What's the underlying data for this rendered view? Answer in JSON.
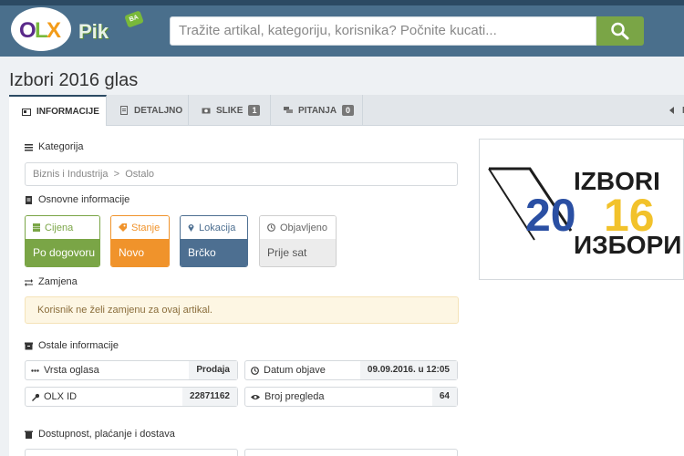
{
  "header": {
    "logo_text": "OLX",
    "pik_text": "Pik",
    "pik_tag": "BA",
    "search_placeholder": "Tražite artikal, kategoriju, korisnika? Počnite kucati..."
  },
  "page": {
    "title": "Izbori 2016 glas"
  },
  "tabs": [
    {
      "label": "INFORMACIJE",
      "icon": "info-card-icon",
      "active": true
    },
    {
      "label": "DETALJNO",
      "icon": "document-icon"
    },
    {
      "label": "SLIKE",
      "icon": "camera-icon",
      "badge": "1"
    },
    {
      "label": "PITANJA",
      "icon": "chat-icon",
      "badge": "0"
    }
  ],
  "tab_right_label": "NA",
  "sections": {
    "kategorija": "Kategorija",
    "osnovne": "Osnovne informacije",
    "zamjena": "Zamjena",
    "ostale": "Ostale informacije",
    "dostupnost": "Dostupnost, plaćanje i dostava"
  },
  "breadcrumb": {
    "level1": "Biznis i Industrija",
    "separator": ">",
    "level2": "Ostalo"
  },
  "cards": [
    {
      "label": "Cijena",
      "value": "Po dogovoru",
      "color": "#7aa546",
      "icon": "money-icon"
    },
    {
      "label": "Stanje",
      "value": "Novo",
      "color": "#f0932b",
      "icon": "tag-icon"
    },
    {
      "label": "Lokacija",
      "value": "Brčko",
      "color": "#4d6f91",
      "icon": "map-pin-icon"
    },
    {
      "label": "Objavljeno",
      "value": "Prije sat",
      "color": "#e6e6e6",
      "icon": "clock-icon"
    }
  ],
  "zamjena_notice": "Korisnik ne želi zamjenu za ovaj artikal.",
  "details": [
    {
      "label": "Vrsta oglasa",
      "value": "Prodaja",
      "icon": "dots-icon"
    },
    {
      "label": "Datum objave",
      "value": "09.09.2016. u 12:05",
      "icon": "clock-icon"
    },
    {
      "label": "OLX ID",
      "value": "22871162",
      "icon": "wrench-icon"
    },
    {
      "label": "Broj pregleda",
      "value": "64",
      "icon": "eye-icon"
    }
  ],
  "election_logo": {
    "top_text": "IZBORI",
    "year": "2016",
    "bottom_text": "ИЗБОРИ"
  }
}
